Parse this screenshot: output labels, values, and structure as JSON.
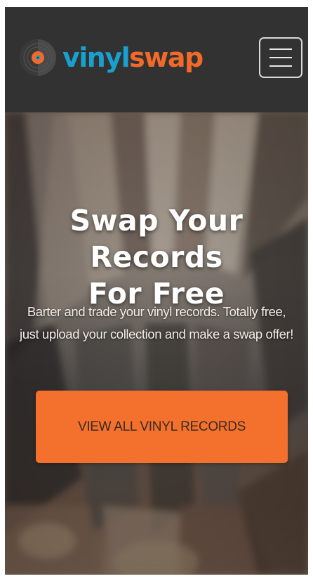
{
  "navbar": {
    "logo": {
      "text_part1": "vinyl",
      "text_part2": "swap",
      "icon": "vinyl-record-icon",
      "colors": {
        "blue": "#1aa0cf",
        "orange": "#f26a2a"
      }
    },
    "menu_button": {
      "icon": "hamburger-menu-icon"
    },
    "background": "#323232"
  },
  "hero": {
    "title_line1": "Swap Your Records",
    "title_line2": "For Free",
    "subtitle_line1": "Barter and trade your vinyl records. Totally free,",
    "subtitle_line2": "just upload your collection and make a swap offer!",
    "cta_label": "VIEW ALL VINYL RECORDS",
    "cta_color": "#f3712c",
    "background_image": "blurred-vinyl-record-crates"
  }
}
